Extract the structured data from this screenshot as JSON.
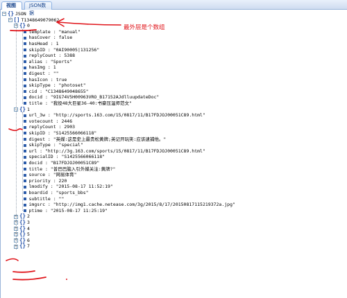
{
  "tabs": [
    {
      "label": "视图",
      "active": true
    },
    {
      "label": "JSON数据",
      "active": false
    }
  ],
  "tree": {
    "root_label": "JSON",
    "array_key": "T1348649079062",
    "items": [
      {
        "index": "0",
        "expanded": true,
        "fields": [
          "template : \"manual\"",
          "hasCover : false",
          "hasHead : 1",
          "skipID : \"0AI90005|131256\"",
          "replyCount : 5388",
          "alias : \"Sports\"",
          "hasImg : 1",
          "digest : \"\"",
          "hasIcon : true",
          "skipType : \"photoset\"",
          "cid : \"C1348649048655\"",
          "docid : \"9IG74V5H00963VRO_B17152AJdlluupdateDoc\"",
          "title : \"我役48大巨星36-40:书豪压温师范文\""
        ]
      },
      {
        "index": "1",
        "expanded": true,
        "fields": [
          "url_3w : \"http://sports.163.com/15/0817/11/B17FDJOJ00051C89.html\"",
          "votecount : 2446",
          "replyCount : 2903",
          "skipID : \"S1425566066118\"",
          "digest : \"英媒:这是史上最贵松黄牌;英记开玩笑:应该逮捕他。\"",
          "skipType : \"special\"",
          "url : \"http://3g.163.com/sports/15/0817/11/B17FDJOJ00051C89.html\"",
          "specialID : \"S1425566066118\"",
          "docid : \"B17FDJOJ00051C89\"",
          "title : \"普巴巴脑入引外媒关注:黄牌?\"",
          "source : \"网易体育\"",
          "priority : 220",
          "lmodify : \"2015-08-17 11:52:19\"",
          "boardid : \"sports_bbs\"",
          "subtitle : \"\"",
          "imgsrc : \"http://img1.cache.netease.com/3g/2015/8/17/20150817115219372a.jpg\"",
          "ptime : \"2015-08-17 11:25:19\""
        ]
      },
      {
        "index": "2",
        "expanded": false,
        "fields": []
      },
      {
        "index": "3",
        "expanded": false,
        "fields": []
      },
      {
        "index": "4",
        "expanded": false,
        "fields": []
      },
      {
        "index": "5",
        "expanded": false,
        "fields": []
      },
      {
        "index": "6",
        "expanded": false,
        "fields": []
      },
      {
        "index": "7",
        "expanded": false,
        "fields": []
      }
    ]
  },
  "annotation": {
    "text": "最外层是个数组",
    "color": "#e0141a"
  },
  "colors": {
    "tab_text": "#15428b",
    "node_icon": "#1e4da8",
    "leaf_icon": "#2a5aa8"
  },
  "icons": {
    "expanded": "⊟",
    "collapsed": "⊞",
    "object": "{}",
    "array": "[]"
  }
}
